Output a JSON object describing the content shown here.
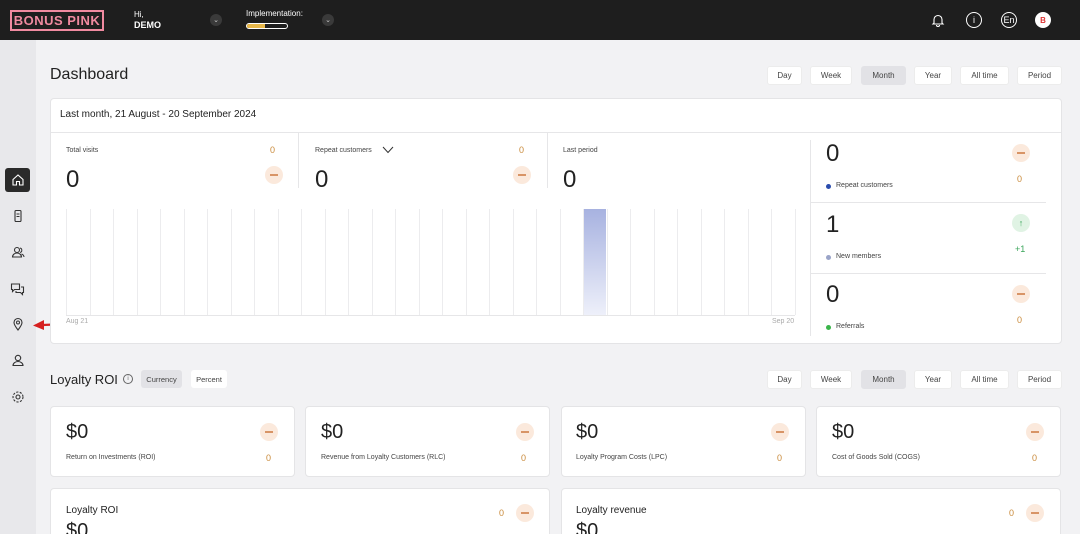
{
  "header": {
    "logo": "BONUS PINK",
    "greeting": "Hi,",
    "user": "DEMO",
    "implementation_label": "Implementation:",
    "implementation_progress": 0.45,
    "language": "En",
    "avatar_letter": "B"
  },
  "dashboard": {
    "title": "Dashboard",
    "periods": [
      "Day",
      "Week",
      "Month",
      "Year",
      "All time",
      "Period"
    ],
    "selected_period": "Month",
    "range_title": "Last month, 21 August - 20 September 2024",
    "stats": {
      "total_visits": {
        "label": "Total visits",
        "value": "0",
        "delta": "0"
      },
      "repeat_customers": {
        "label": "Repeat customers",
        "value": "0",
        "delta": "0"
      },
      "last_period": {
        "label": "Last period",
        "value": "0"
      }
    },
    "chart": {
      "x_start": "Aug 21",
      "x_end": "Sep 20"
    },
    "side_stats": [
      {
        "value": "0",
        "label": "Repeat customers",
        "delta": "0",
        "dot_color": "#2a4cad"
      },
      {
        "value": "1",
        "label": "New members",
        "delta": "+1",
        "dot_color": "#9aa4c8"
      },
      {
        "value": "0",
        "label": "Referrals",
        "delta": "0",
        "dot_color": "#3ab54a"
      }
    ]
  },
  "roi": {
    "title": "Loyalty ROI",
    "toggle": [
      "Currency",
      "Percent"
    ],
    "periods": [
      "Day",
      "Week",
      "Month",
      "Year",
      "All time",
      "Period"
    ],
    "cards": [
      {
        "value": "$0",
        "label": "Return on Investments (ROI)",
        "delta": "0"
      },
      {
        "value": "$0",
        "label": "Revenue from Loyalty Customers (RLC)",
        "delta": "0"
      },
      {
        "value": "$0",
        "label": "Loyalty Program Costs (LPC)",
        "delta": "0"
      },
      {
        "value": "$0",
        "label": "Cost of Goods Sold (COGS)",
        "delta": "0"
      }
    ],
    "bottom_cards": [
      {
        "title": "Loyalty ROI",
        "value": "$0",
        "delta": "0"
      },
      {
        "title": "Loyalty revenue",
        "value": "$0",
        "delta": "0"
      }
    ]
  }
}
